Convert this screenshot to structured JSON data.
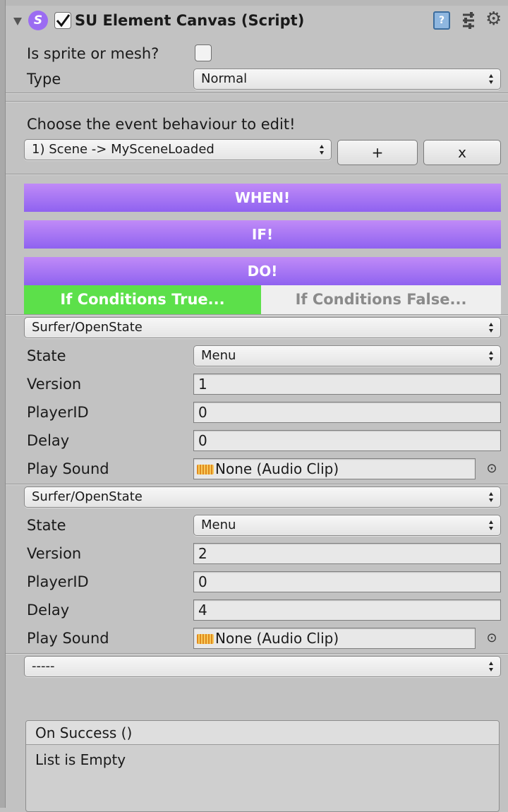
{
  "component": {
    "title": "SU Element Canvas (Script)",
    "enabled": true,
    "script_icon_letter": "S"
  },
  "props": {
    "is_sprite_label": "Is sprite or mesh?",
    "is_sprite_checked": false,
    "type_label": "Type",
    "type_value": "Normal"
  },
  "event": {
    "choose_label": "Choose the event behaviour to edit!",
    "selected": "1) Scene -> MySceneLoaded",
    "add_label": "+",
    "remove_label": "x"
  },
  "sections": {
    "when": "WHEN!",
    "if": "IF!",
    "do": "DO!"
  },
  "tabs": {
    "true_label": "If Conditions True...",
    "false_label": "If Conditions False..."
  },
  "actions": [
    {
      "action": "Surfer/OpenState",
      "state_label": "State",
      "state": "Menu",
      "version_label": "Version",
      "version": "1",
      "player_label": "PlayerID",
      "player": "0",
      "delay_label": "Delay",
      "delay": "0",
      "sound_label": "Play Sound",
      "sound": "None (Audio Clip)"
    },
    {
      "action": "Surfer/OpenState",
      "state_label": "State",
      "state": "Menu",
      "version_label": "Version",
      "version": "2",
      "player_label": "PlayerID",
      "player": "0",
      "delay_label": "Delay",
      "delay": "4",
      "sound_label": "Play Sound",
      "sound": "None (Audio Clip)"
    }
  ],
  "new_action": "-----",
  "on_success": {
    "header": "On Success ()",
    "empty": "List is Empty"
  },
  "colors": {
    "purple_top": "#c08bf7",
    "purple_bottom": "#8f62f0",
    "tab_active": "#5ce04a",
    "icon_purple": "#9b6cf2"
  }
}
